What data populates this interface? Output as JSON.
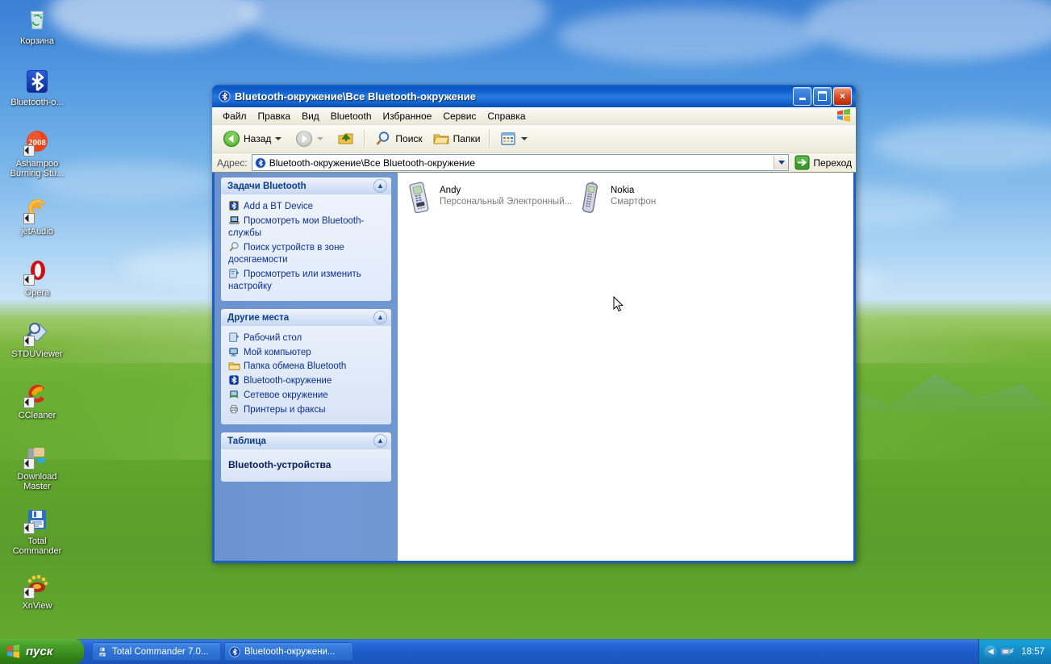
{
  "desktop": {
    "icons": [
      {
        "label": "Корзина",
        "icon": "recycle-bin-icon",
        "shortcut": false
      },
      {
        "label": "Bluetooth-о...",
        "icon": "bluetooth-icon",
        "shortcut": false
      },
      {
        "label": "Ashampoo Burning Stu...",
        "icon": "ashampoo-2008-icon",
        "shortcut": true
      },
      {
        "label": "jetAudio",
        "icon": "jetaudio-icon",
        "shortcut": true
      },
      {
        "label": "Opera",
        "icon": "opera-icon",
        "shortcut": true
      },
      {
        "label": "STDUViewer",
        "icon": "stduviewer-icon",
        "shortcut": true
      },
      {
        "label": "CCleaner",
        "icon": "ccleaner-icon",
        "shortcut": true
      },
      {
        "label": "Download Master",
        "icon": "download-master-icon",
        "shortcut": true
      },
      {
        "label": "Total Commander",
        "icon": "total-commander-icon",
        "shortcut": true
      },
      {
        "label": "XnView",
        "icon": "xnview-icon",
        "shortcut": true
      }
    ]
  },
  "window": {
    "title": "Bluetooth-окружение\\Все Bluetooth-окружение",
    "title_icon": "bluetooth-icon",
    "controls": {
      "minimize": "minimize-icon",
      "maximize": "maximize-icon",
      "close": "×"
    },
    "menu": [
      {
        "label": "Файл",
        "accel": "Ф"
      },
      {
        "label": "Правка",
        "accel": "П"
      },
      {
        "label": "Вид",
        "accel": "В"
      },
      {
        "label": "Bluetooth",
        "accel": "B"
      },
      {
        "label": "Избранное",
        "accel": "И"
      },
      {
        "label": "Сервис",
        "accel": "е"
      },
      {
        "label": "Справка",
        "accel": "С"
      }
    ],
    "toolbar": {
      "back_label": "Назад",
      "forward_label": "",
      "up_icon": "up-folder-icon",
      "search_label": "Поиск",
      "folders_label": "Папки",
      "views_icon": "views-icon"
    },
    "address": {
      "label": "Адрес:",
      "value": "Bluetooth-окружение\\Все Bluetooth-окружение",
      "icon": "bluetooth-icon",
      "go_label": "Переход"
    },
    "sidebar": {
      "panels": [
        {
          "title": "Задачи Bluetooth",
          "collapse_icon": "chevron-up-icon",
          "items": [
            {
              "label": "Add a BT Device",
              "icon": "bluetooth-add-icon"
            },
            {
              "label": "Просмотреть мои Bluetooth-службы",
              "icon": "laptop-icon"
            },
            {
              "label": "Поиск устройств в зоне досягаемости",
              "icon": "magnifier-icon"
            },
            {
              "label": "Просмотреть или изменить настройку",
              "icon": "settings-icon"
            }
          ]
        },
        {
          "title": "Другие места",
          "collapse_icon": "chevron-up-icon",
          "items": [
            {
              "label": "Рабочий стол",
              "icon": "desktop-icon"
            },
            {
              "label": "Мой компьютер",
              "icon": "my-computer-icon"
            },
            {
              "label": "Папка обмена Bluetooth",
              "icon": "folder-icon"
            },
            {
              "label": "Bluetooth-окружение",
              "icon": "bluetooth-icon"
            },
            {
              "label": "Сетевое окружение",
              "icon": "network-icon"
            },
            {
              "label": "Принтеры и факсы",
              "icon": "printer-icon"
            }
          ]
        },
        {
          "title": "Таблица",
          "collapse_icon": "chevron-up-icon",
          "detail_name": "Bluetooth-устройства"
        }
      ]
    },
    "files": [
      {
        "name": "Andy",
        "subtitle": "Персональный Электронный...",
        "icon": "pda-device-icon"
      },
      {
        "name": "Nokia",
        "subtitle": "Смартфон",
        "icon": "phone-device-icon"
      }
    ]
  },
  "taskbar": {
    "start_label": "пуск",
    "start_icon": "windows-flag-icon",
    "tasks": [
      {
        "label": "Total Commander 7.0...",
        "icon": "total-commander-icon"
      },
      {
        "label": "Bluetooth-окружени...",
        "icon": "bluetooth-icon"
      }
    ],
    "tray": {
      "expand_icon": "chevron-left-icon",
      "network_icon": "network-tray-icon",
      "time": "18:57"
    }
  },
  "colors": {
    "title_blue": "#0a55c2",
    "window_frame": "#1b5fc0",
    "sidebar_blue": "#6f97d2",
    "link_blue": "#0a2f9c",
    "panel_header": "#0c3d91",
    "taskbar_blue": "#2a6ad8",
    "start_green": "#3f9424"
  }
}
